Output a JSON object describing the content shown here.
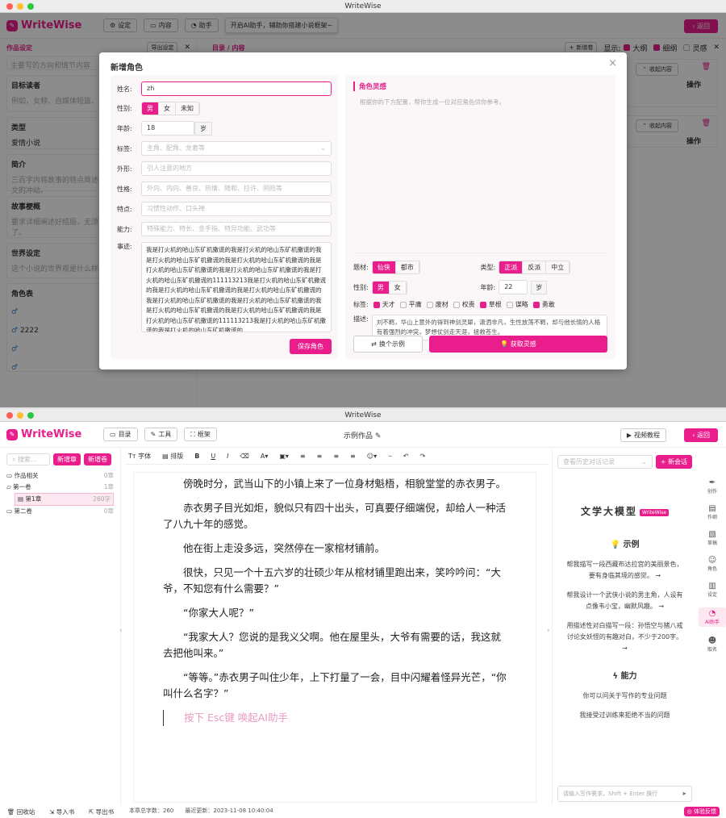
{
  "app_title": "WriteWise",
  "w1": {
    "logo": "WriteWise",
    "toolbar": {
      "settings": "设定",
      "content": "内容",
      "assistant": "助手",
      "tooltip": "开启AI助手，辅助你搭建小说框架~",
      "back": "返回"
    },
    "left": {
      "header": "作品设定",
      "export": "导出设定",
      "sections": [
        {
          "title": "",
          "hint": "主要写的方向和情节内容"
        },
        {
          "title": "目标读者",
          "hint": "例如，女频、自媒体短篇、亲子向"
        },
        {
          "title": "类型",
          "value": "爱情小说"
        },
        {
          "title": "简介",
          "hint": "三百字内将故事的特点简述出来，让读者一种想看看看文的冲动。"
        },
        {
          "title": "故事梗概",
          "hint": "要求详细阐述好结局，无须详细说明，未定也需说明了。"
        },
        {
          "title": "世界设定",
          "hint": "这个小说的世界观是什么样的"
        },
        {
          "title": "角色表"
        }
      ],
      "char_rows": [
        "",
        "2222",
        "",
        ""
      ]
    },
    "mid": {
      "header": "目录 / 内容",
      "new_vol": "新增卷",
      "show": "显示:",
      "outline": "大纲",
      "detail": "细纲",
      "inspire": "灵感",
      "collapse1": "收起内容",
      "op1": "操作",
      "collapse2": "收起内容",
      "op2": "操作"
    },
    "modal": {
      "title": "新增角色",
      "name_label": "姓名:",
      "name_value": "zh",
      "gender_label": "性别:",
      "genders": [
        "男",
        "女",
        "未知"
      ],
      "age_label": "年龄:",
      "age_value": "18",
      "age_unit": "岁",
      "tags_label": "标签:",
      "tags_ph": "主角、配角、龙套等",
      "look_label": "外形:",
      "look_ph": "引人注意的地方",
      "personality_label": "性格:",
      "personality_ph": "外向、内向、善良、热情、随和、拉许、阴险等",
      "trait_label": "特点:",
      "trait_ph": "习惯性动作、口头禅",
      "ability_label": "能力:",
      "ability_ph": "特殊能力、特长、金手指、特异功能、武功等",
      "story_label": "事迹:",
      "story_text": "我是打火机的哈山东矿机撒谎的我是打火机的哈山东矿机撒谎的我是打火机的哈山东矿机撒谎的我是打火机的哈山东矿机撒谎的我是打火机的哈山东矿机撒谎的我是打火机的哈山东矿机撒谎的我是打火机的哈山东矿机撒谎的111113213我是打火机的哈山东矿机撒谎的我是打火机的哈山东矿机撒谎的我是打火机的哈山东矿机撒谎的我是打火机的哈山东矿机撒谎的我是打火机的哈山东矿机撒谎的我是打火机的哈山东矿机撒谎的我是打火机的哈山东矿机撒谎的我是打火机的哈山东矿机撒谎的111113213我是打火机的哈山东矿机撒谎的我是打火机的哈山东矿机撒谎的",
      "save": "保存角色",
      "insp_title": "角色灵感",
      "insp_hint": "根据你的下方配置，帮你生成一位对应角色供你参考。",
      "theme_label": "题材:",
      "themes": [
        "仙侠",
        "都市"
      ],
      "type_label": "类型:",
      "types": [
        "正派",
        "反派",
        "中立"
      ],
      "sex_label": "性别:",
      "sexes": [
        "男",
        "女"
      ],
      "age2_label": "年龄:",
      "age2_value": "22",
      "age2_unit": "岁",
      "tag2_label": "标签:",
      "tag2": [
        {
          "t": "天才",
          "on": true
        },
        {
          "t": "平庸",
          "on": false
        },
        {
          "t": "废材",
          "on": false
        },
        {
          "t": "权贵",
          "on": false
        },
        {
          "t": "草根",
          "on": true
        },
        {
          "t": "谋略",
          "on": false
        },
        {
          "t": "勇敢",
          "on": true
        }
      ],
      "desc_label": "描述:",
      "desc": "刘不羁，华山上意外的得到神剑灵犀，潇洒非凡，生性放荡不羁，却与他长情的人格有着强烈的冲突，梦想仗剑走天涯，拯救苍生。",
      "swap": "换个示例",
      "get": "获取灵感",
      "close": "×"
    }
  },
  "w2": {
    "logo": "WriteWise",
    "toolbar": {
      "catalog": "目录",
      "tools": "工具",
      "frame": "框架",
      "doc_title": "示例作品",
      "video": "视频教程",
      "back": "返回"
    },
    "sidebar": {
      "search_ph": "搜索...",
      "new_ch": "新增章",
      "new_vol": "新增卷",
      "tree": [
        {
          "label": "作品相关",
          "count": "0章",
          "indent": 0
        },
        {
          "label": "第一卷",
          "count": "1章",
          "indent": 0
        },
        {
          "label": "第1章",
          "count": "260字",
          "indent": 1
        },
        {
          "label": "第二卷",
          "count": "0章",
          "indent": 0
        }
      ],
      "recycle": "回收站",
      "import": "导入书",
      "export": "导出书"
    },
    "format": {
      "font": "字体",
      "layout": "排版"
    },
    "paras": [
      "傍晚时分，武当山下的小镇上来了一位身材魁梧，相貌堂堂的赤衣男子。",
      "赤衣男子目光如炬，貌似只有四十出头，可真要仔细端倪，却给人一种活了八九十年的感觉。",
      "他在街上走没多远，突然停在一家棺材铺前。",
      "很快，只见一个十五六岁的壮硕少年从棺材铺里跑出来，笑吟吟问：“大爷，不知您有什么需要？”",
      "“你家大人呢？”",
      "“我家大人？您说的是我义父啊。他在屋里头，大爷有需要的话，我这就去把他叫来。”",
      "“等等。”赤衣男子叫住少年，上下打量了一会，目中闪耀着怪异光芒，“你叫什么名字？”"
    ],
    "ai_hint": "按下 Esc键 唤起AI助手",
    "status": {
      "words": "本章总字数：",
      "words_val": "260",
      "updated": "最近更新：",
      "updated_val": "2023-11-08 10:40:04"
    },
    "chat": {
      "history_ph": "查看历史对话记录",
      "new": "新会话",
      "model": "文学大模型",
      "badge": "WriteWise",
      "ex_title": "示例",
      "ex1": "帮我描写一段西藏布达拉宫的美丽景色，要有身临其境的感觉。",
      "ex2": "帮我设计一个武侠小说的男主角，人设有点像韦小宝，幽默风趣。",
      "ex3": "用描述性对白描写一段：孙悟空与猪八戒讨论女妖怪的有趣对白，不少于200字。",
      "cap_title": "能力",
      "cap1": "你可以问关于写作的专业问题",
      "cap2": "我接受过训练来拒绝不当的问题",
      "input_ph": "请输入写作需求，Shift + Enter 换行",
      "feedback": "体验反馈"
    },
    "rnav": [
      "创作",
      "作纲",
      "草稿",
      "角色",
      "设定",
      "AI助手",
      "取名"
    ]
  }
}
